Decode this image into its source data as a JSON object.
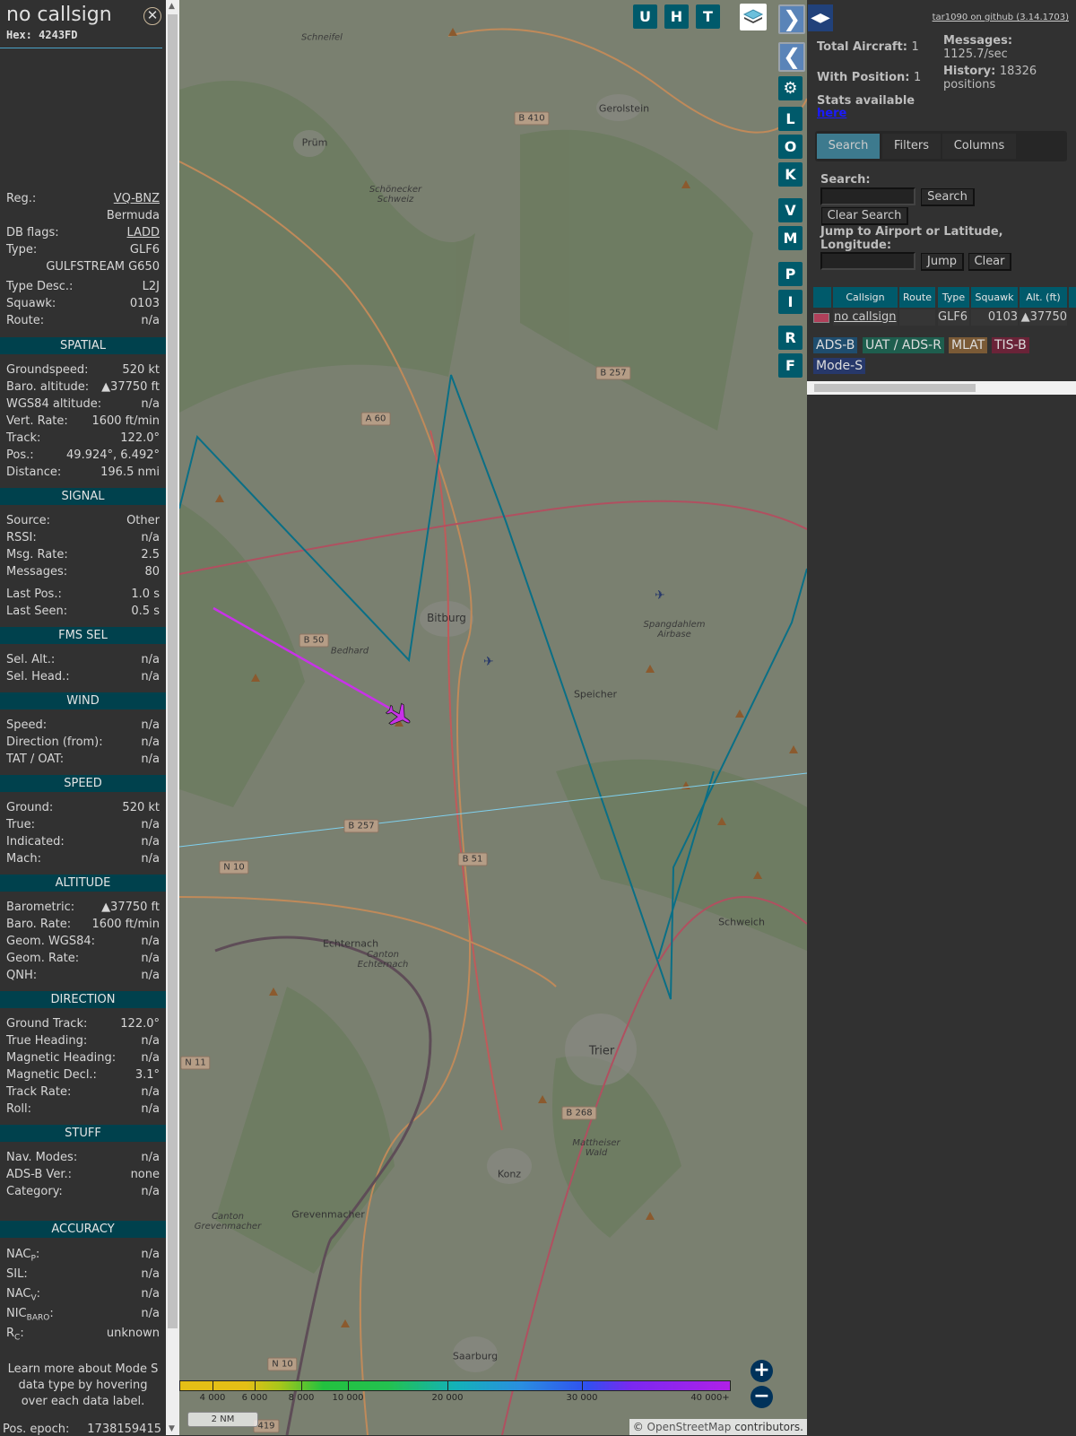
{
  "detail": {
    "callsign": "no callsign",
    "hex_label": "Hex:",
    "hex": "4243FD",
    "close_icon": "circle-x-icon",
    "top_rows": [
      {
        "label": "Reg.:",
        "value": "VQ-BNZ",
        "link": true
      },
      {
        "label": "",
        "value": "Bermuda"
      },
      {
        "label": "DB flags:",
        "value": "LADD",
        "link": true
      },
      {
        "label": "Type:",
        "value": "GLF6"
      },
      {
        "label": "",
        "value": "GULFSTREAM G650"
      },
      {
        "label": "Type Desc.:",
        "value": "L2J"
      },
      {
        "label": "Squawk:",
        "value": "0103"
      },
      {
        "label": "Route:",
        "value": "n/a"
      }
    ],
    "sections": [
      {
        "title": "SPATIAL",
        "rows": [
          {
            "label": "Groundspeed:",
            "value": "520 kt"
          },
          {
            "label": "Baro. altitude:",
            "value": "▲37750 ft"
          },
          {
            "label": "WGS84 altitude:",
            "value": "n/a"
          },
          {
            "label": "Vert. Rate:",
            "value": "1600 ft/min"
          },
          {
            "label": "Track:",
            "value": "122.0°"
          },
          {
            "label": "Pos.:",
            "value": "49.924°, 6.492°"
          },
          {
            "label": "Distance:",
            "value": "196.5 nmi"
          }
        ]
      },
      {
        "title": "SIGNAL",
        "rows": [
          {
            "label": "Source:",
            "value": "Other"
          },
          {
            "label": "RSSI:",
            "value": "n/a"
          },
          {
            "label": "Msg. Rate:",
            "value": "2.5"
          },
          {
            "label": "Messages:",
            "value": "80"
          },
          {
            "label": "Last Pos.:",
            "value": "1.0 s"
          },
          {
            "label": "Last Seen:",
            "value": "0.5 s"
          }
        ]
      },
      {
        "title": "FMS SEL",
        "rows": [
          {
            "label": "Sel. Alt.:",
            "value": "n/a"
          },
          {
            "label": "Sel. Head.:",
            "value": "n/a"
          }
        ]
      },
      {
        "title": "WIND",
        "rows": [
          {
            "label": "Speed:",
            "value": "n/a"
          },
          {
            "label": "Direction (from):",
            "value": "n/a"
          },
          {
            "label": "TAT / OAT:",
            "value": "n/a"
          }
        ]
      },
      {
        "title": "SPEED",
        "rows": [
          {
            "label": "Ground:",
            "value": "520 kt"
          },
          {
            "label": "True:",
            "value": "n/a"
          },
          {
            "label": "Indicated:",
            "value": "n/a"
          },
          {
            "label": "Mach:",
            "value": "n/a"
          }
        ]
      },
      {
        "title": "ALTITUDE",
        "rows": [
          {
            "label": "Barometric:",
            "value": "▲37750 ft"
          },
          {
            "label": "Baro. Rate:",
            "value": "1600 ft/min"
          },
          {
            "label": "Geom. WGS84:",
            "value": "n/a"
          },
          {
            "label": "Geom. Rate:",
            "value": "n/a"
          },
          {
            "label": "QNH:",
            "value": "n/a"
          }
        ]
      },
      {
        "title": "DIRECTION",
        "rows": [
          {
            "label": "Ground Track:",
            "value": "122.0°"
          },
          {
            "label": "True Heading:",
            "value": "n/a"
          },
          {
            "label": "Magnetic Heading:",
            "value": "n/a"
          },
          {
            "label": "Magnetic Decl.:",
            "value": "3.1°"
          },
          {
            "label": "Track Rate:",
            "value": "n/a"
          },
          {
            "label": "Roll:",
            "value": "n/a"
          }
        ]
      },
      {
        "title": "STUFF",
        "rows": [
          {
            "label": "Nav. Modes:",
            "value": "n/a"
          },
          {
            "label": "ADS-B Ver.:",
            "value": "none"
          },
          {
            "label": "Category:",
            "value": "n/a"
          }
        ]
      },
      {
        "title": "ACCURACY",
        "rows": [
          {
            "label": "NAC",
            "sub": "P",
            "suffix": ":",
            "value": "n/a"
          },
          {
            "label": "SIL:",
            "value": "n/a"
          },
          {
            "label": "NAC",
            "sub": "V",
            "suffix": ":",
            "value": "n/a"
          },
          {
            "label": "NIC",
            "sub": "BARO",
            "suffix": ":",
            "value": "n/a"
          },
          {
            "label": "R",
            "sub": "C",
            "suffix": ":",
            "value": "unknown"
          }
        ]
      }
    ],
    "learn_more": "Learn more about Mode S data type by hovering over each data label.",
    "pos_epoch_label": "Pos. epoch:",
    "pos_epoch": "1738159415"
  },
  "map": {
    "top_buttons": [
      "U",
      "H",
      "T"
    ],
    "layers_icon": "layers-icon",
    "side_buttons": [
      "L",
      "O",
      "K",
      "V",
      "M",
      "P",
      "I",
      "R",
      "F"
    ],
    "expand_icon": "chevron-right-icon",
    "collapse_icon": "chevron-left-icon",
    "settings_icon": "gear-icon",
    "towns": [
      "Prüm",
      "Gerolstein",
      "Bitburg",
      "Speicher",
      "Trier",
      "Konz",
      "Saarburg",
      "Schweich",
      "Echternach",
      "Grevenmacher"
    ],
    "areas": [
      "Schneifel",
      "Schönecker Schweiz",
      "Bedhard",
      "Spangdahlem Airbase",
      "Canton Echternach",
      "Mattheiser Wald",
      "Canton Grevenmacher"
    ],
    "roads": [
      "B 410",
      "A 60",
      "B 257",
      "B 50",
      "B 257",
      "B 51",
      "N 10",
      "N 11",
      "B 268",
      "N 10",
      "419"
    ],
    "altitude_legend": [
      "4 000",
      "6 000",
      "8 000",
      "10 000",
      "20 000",
      "30 000",
      "40 000+"
    ],
    "zoom_in": "+",
    "zoom_out": "−",
    "scale": "2 NM",
    "attribution_prefix": "© ",
    "attribution_link": "OpenStreetMap",
    "attribution_suffix": " contributors.",
    "colors": {
      "track": "#0a6f86",
      "selected_track": "#c832e8",
      "plane": "#c832e8",
      "route_line": "#7fd0ee"
    }
  },
  "panel": {
    "toggle_icon": "left-right-arrows-icon",
    "github": "tar1090 on github (3.14.1703)",
    "total_aircraft_label": "Total Aircraft:",
    "total_aircraft": "1",
    "with_position_label": "With Position:",
    "with_position": "1",
    "stats_label": "Stats available",
    "stats_link": "here",
    "messages_label": "Messages:",
    "messages": "1125.7/sec",
    "history_label": "History:",
    "history": "18326",
    "history_unit": "positions",
    "tabs": [
      "Search",
      "Filters",
      "Columns"
    ],
    "search_label": "Search:",
    "search_value": "",
    "search_button": "Search",
    "clear_search_button": "Clear Search",
    "jump_label": "Jump to Airport or Latitude, Longitude:",
    "jump_value": "",
    "jump_button": "Jump",
    "clear_button": "Clear",
    "table": {
      "columns": [
        "",
        "Callsign",
        "Route",
        "Type",
        "Squawk",
        "Alt. (ft)"
      ],
      "rows": [
        {
          "flag_icon": "bermuda-flag-icon",
          "callsign": "no callsign",
          "route": "",
          "type": "GLF6",
          "squawk": "0103",
          "alt": "▲37750"
        }
      ]
    },
    "legend": [
      {
        "label": "ADS-B",
        "color": "#1f4d6e"
      },
      {
        "label": "UAT / ADS-R",
        "color": "#1e5e4e"
      },
      {
        "label": "MLAT",
        "color": "#7a5a36"
      },
      {
        "label": "TIS-B",
        "color": "#6a2338"
      },
      {
        "label": "Mode-S",
        "color": "#27386a"
      }
    ]
  }
}
